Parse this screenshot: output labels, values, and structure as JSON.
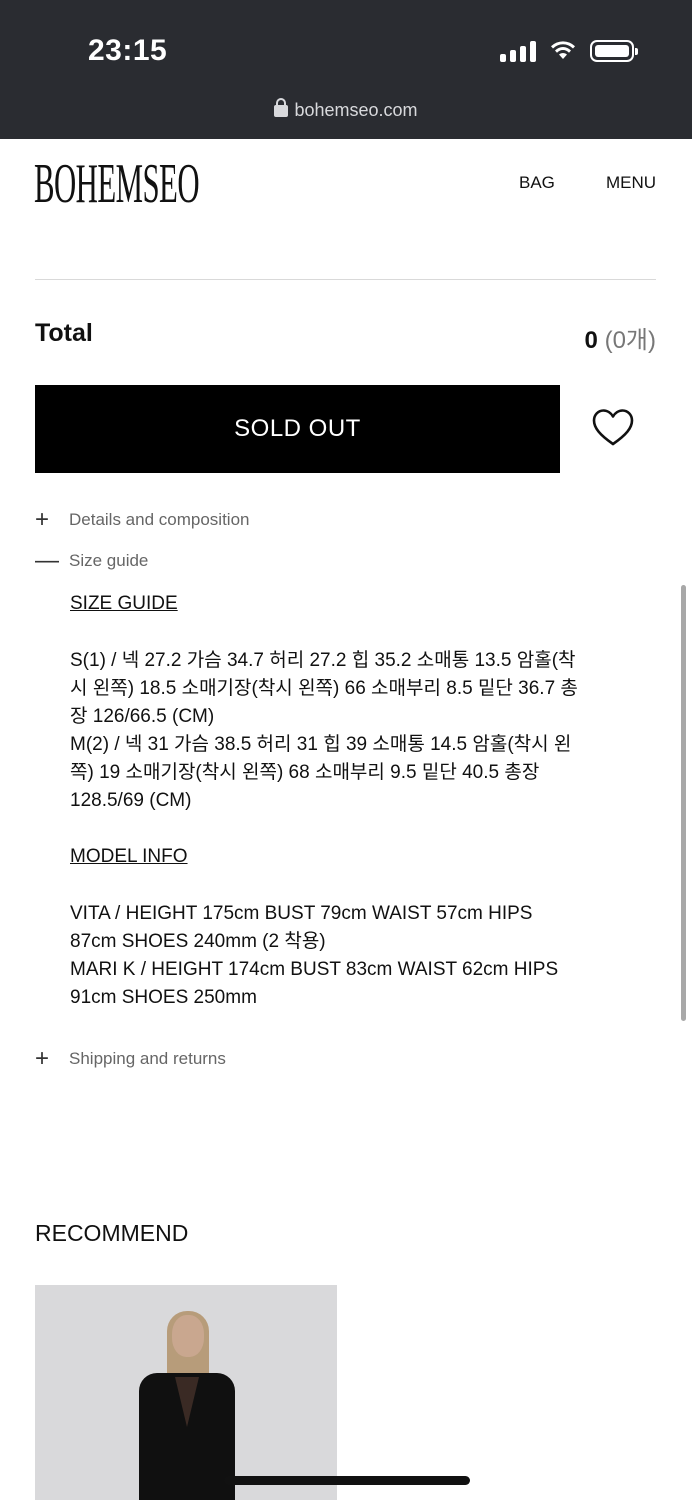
{
  "status_bar": {
    "time": "23:15"
  },
  "browser": {
    "url": "bohemseo.com"
  },
  "header": {
    "logo": "BOHEMSEO",
    "bag": "BAG",
    "menu": "MENU"
  },
  "total": {
    "label": "Total",
    "value": "0",
    "count": "(0개)"
  },
  "actions": {
    "sold_out": "SOLD OUT"
  },
  "accordion": {
    "details": {
      "symbol": "+",
      "label": "Details and composition"
    },
    "size_guide": {
      "symbol": "—",
      "label": "Size guide"
    },
    "shipping": {
      "symbol": "+",
      "label": "Shipping and returns"
    }
  },
  "size_guide": {
    "title": "SIZE GUIDE",
    "lines": [
      "S(1) / 넥 27.2 가슴 34.7 허리 27.2 힙 35.2 소매통 13.5 암홀(착",
      "시 왼쪽) 18.5 소매기장(착시 왼쪽) 66 소매부리 8.5 밑단 36.7 총",
      "장 126/66.5 (CM)",
      "M(2) / 넥 31 가슴 38.5 허리 31 힙 39 소매통 14.5 암홀(착시 왼",
      "쪽) 19 소매기장(착시 왼쪽) 68 소매부리 9.5 밑단 40.5 총장",
      "128.5/69 (CM)"
    ]
  },
  "model_info": {
    "title": "MODEL INFO",
    "lines": [
      "VITA / HEIGHT 175cm BUST 79cm WAIST 57cm HIPS",
      "87cm SHOES 240mm (2 착용)",
      "MARI K / HEIGHT 174cm BUST 83cm WAIST 62cm HIPS",
      "91cm SHOES 250mm"
    ]
  },
  "recommend": {
    "title": "RECOMMEND"
  }
}
